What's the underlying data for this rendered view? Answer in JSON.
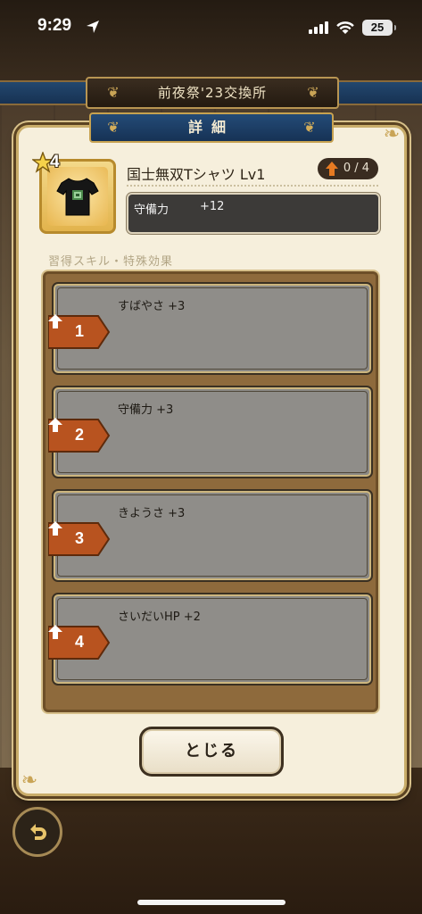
{
  "status_bar": {
    "time": "9:29",
    "battery": "25"
  },
  "shop": {
    "title": "前夜祭'23交換所"
  },
  "dialog": {
    "title": "詳細",
    "item": {
      "rarity": "4",
      "name": "国士無双Tシャツ Lv1",
      "upgrade": "0 / 4",
      "stat_label": "守備力",
      "stat_value": "+12"
    },
    "section_label": "習得スキル・特殊効果",
    "skills": [
      {
        "level": "1",
        "text": "すばやさ +3"
      },
      {
        "level": "2",
        "text": "守備力 +3"
      },
      {
        "level": "3",
        "text": "きようさ +3"
      },
      {
        "level": "4",
        "text": "さいだいHP +2"
      }
    ],
    "close_label": "とじる"
  },
  "colors": {
    "dialog_bg": "#f6efdc",
    "title_band": "#1c3c62",
    "skill_card": "#8a8884",
    "skill_tag": "#c0521d",
    "panel": "#8e6a3c"
  },
  "icons": {
    "back": "back-arrow-icon",
    "upgrade": "up-arrow-icon",
    "item": "tshirt-icon"
  }
}
